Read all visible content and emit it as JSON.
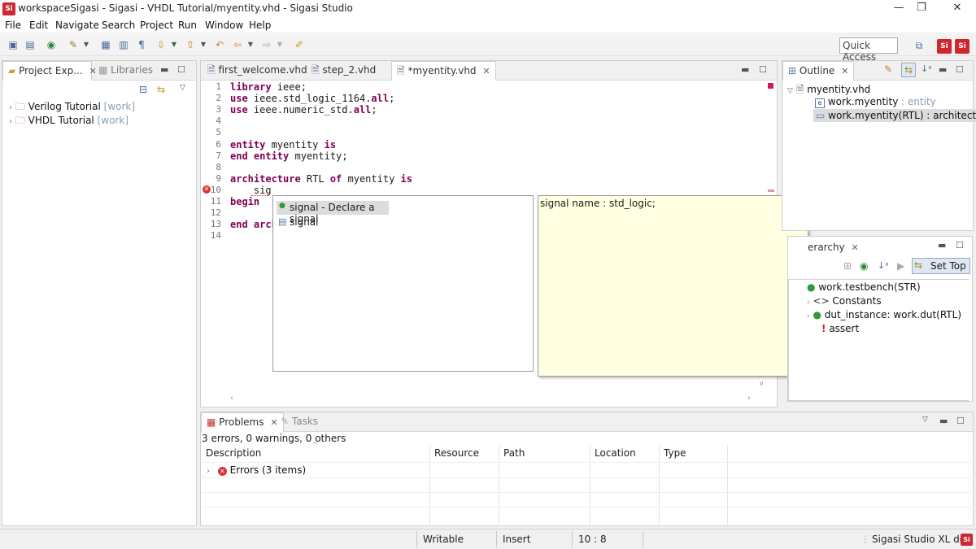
{
  "window": {
    "title": "workspaceSigasi - Sigasi - VHDL Tutorial/myentity.vhd - Sigasi Studio",
    "app_icon_text": "Si",
    "minimize": "—",
    "restore": "❐",
    "close": "✕"
  },
  "menu": [
    "File",
    "Edit",
    "Navigate",
    "Search",
    "Project",
    "Run",
    "Window",
    "Help"
  ],
  "toolbar": {
    "quick_access": "Quick Access"
  },
  "left_panel": {
    "tabs": [
      {
        "label": "Project Exp...",
        "active": true
      },
      {
        "label": "Libraries",
        "active": false
      }
    ],
    "tree": [
      {
        "label": "Verilog Tutorial",
        "tag": "[work]"
      },
      {
        "label": "VHDL Tutorial",
        "tag": "[work]"
      }
    ]
  },
  "editor": {
    "tabs": [
      {
        "label": "first_welcome.vhd",
        "active": false
      },
      {
        "label": "step_2.vhd",
        "active": false
      },
      {
        "label": "*myentity.vhd",
        "active": true
      }
    ],
    "line_numbers": [
      "1",
      "2",
      "3",
      "4",
      "5",
      "6",
      "7",
      "8",
      "9",
      "10",
      "11",
      "12",
      "13",
      "14"
    ],
    "code": [
      [
        {
          "t": "library",
          "k": true
        },
        {
          "t": " ieee;"
        }
      ],
      [
        {
          "t": "use",
          "k": true
        },
        {
          "t": " ieee.std_logic_1164."
        },
        {
          "t": "all",
          "k": true
        },
        {
          "t": ";"
        }
      ],
      [
        {
          "t": "use",
          "k": true
        },
        {
          "t": " ieee.numeric_std."
        },
        {
          "t": "all",
          "k": true
        },
        {
          "t": ";"
        }
      ],
      [],
      [],
      [
        {
          "t": "entity",
          "k": true
        },
        {
          "t": " myentity "
        },
        {
          "t": "is",
          "k": true
        }
      ],
      [
        {
          "t": "end entity",
          "k": true
        },
        {
          "t": " myentity;"
        }
      ],
      [],
      [
        {
          "t": "architecture",
          "k": true
        },
        {
          "t": " RTL "
        },
        {
          "t": "of",
          "k": true
        },
        {
          "t": " myentity "
        },
        {
          "t": "is",
          "k": true
        }
      ],
      [
        {
          "t": "    sig"
        }
      ],
      [
        {
          "t": "begin",
          "k": true
        }
      ],
      [],
      [
        {
          "t": "end arch",
          "k": true
        }
      ],
      []
    ]
  },
  "autocomplete": {
    "items": [
      {
        "label": "signal - Declare a signal",
        "selected": true
      },
      {
        "label": "signal",
        "selected": false
      }
    ],
    "doc": "signal name : std_logic;"
  },
  "outline": {
    "tab": "Outline",
    "tree": [
      {
        "label": "myentity.vhd",
        "sub": ""
      },
      {
        "label": "work.myentity",
        "sub": " : entity"
      },
      {
        "label": "work.myentity(RTL) : architecture",
        "sub": ""
      }
    ]
  },
  "hierarchy": {
    "tab": "erarchy",
    "set_top": "Set Top",
    "tree": [
      {
        "label": "work.testbench(STR)"
      },
      {
        "label": "Constants"
      },
      {
        "label": "dut_instance: work.dut(RTL)"
      },
      {
        "label": "assert"
      }
    ]
  },
  "problems": {
    "tabs": [
      {
        "label": "Problems",
        "active": true
      },
      {
        "label": "Tasks",
        "active": false
      }
    ],
    "summary": "3 errors, 0 warnings, 0 others",
    "columns": [
      "Description",
      "Resource",
      "Path",
      "Location",
      "Type"
    ],
    "rows": [
      {
        "label": "Errors (3 items)"
      }
    ]
  },
  "status": {
    "writable": "Writable",
    "insert": "Insert",
    "position": "10 : 8",
    "product": "Sigasi Studio XL doc"
  }
}
